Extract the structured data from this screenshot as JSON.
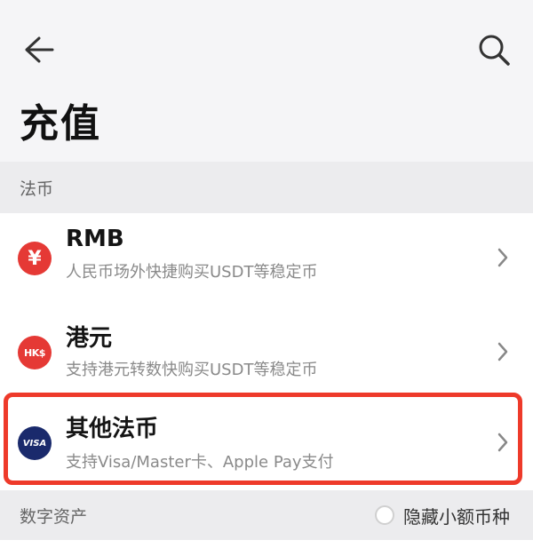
{
  "header": {
    "back_icon": "arrow-left-icon",
    "search_icon": "search-icon",
    "title": "充值"
  },
  "sections": {
    "fiat_label": "法币",
    "digital_label": "数字资产",
    "hide_small_label": "隐藏小额币种"
  },
  "items": [
    {
      "icon_text": "¥",
      "title": "RMB",
      "subtitle": "人民币场外快捷购买USDT等稳定币"
    },
    {
      "icon_text": "HK$",
      "title": "港元",
      "subtitle": "支持港元转数快购买USDT等稳定币"
    },
    {
      "icon_text": "VISA",
      "title": "其他法币",
      "subtitle": "支持Visa/Master卡、Apple Pay支付"
    }
  ],
  "colors": {
    "accent_red": "#e53935",
    "highlight_border": "#ee3a2a",
    "visa_navy": "#1a2a6c"
  }
}
